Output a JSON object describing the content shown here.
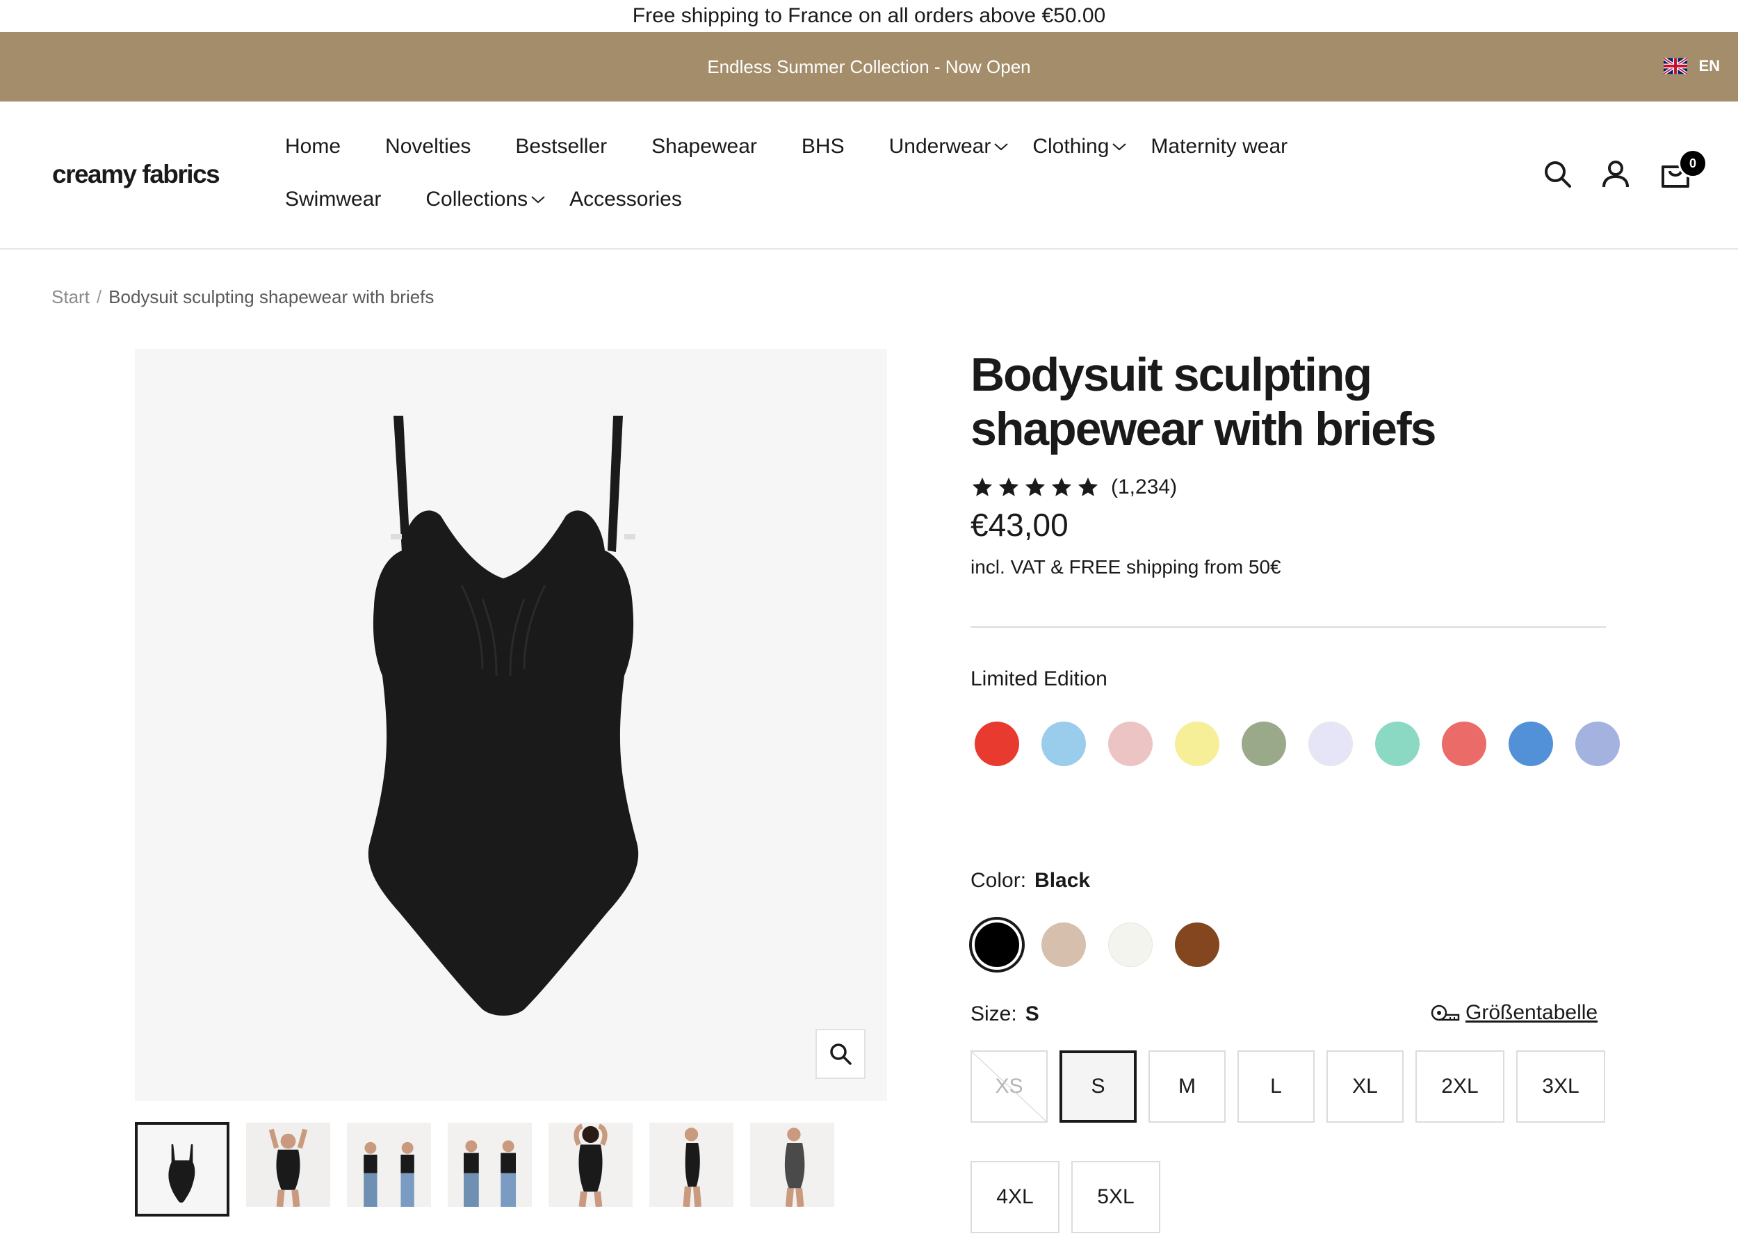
{
  "topbar": {
    "text": "Free shipping to France on all orders above €50.00"
  },
  "announcement": {
    "text": "Endless Summer Collection - Now Open",
    "bg_color": "#a48d6a"
  },
  "language": {
    "code": "EN",
    "flag_icon": "uk-flag-icon"
  },
  "header": {
    "logo": "creamy fabrics",
    "nav_row1": [
      {
        "label": "Home"
      },
      {
        "label": "Novelties"
      },
      {
        "label": "Bestseller"
      },
      {
        "label": "Shapewear"
      },
      {
        "label": "BHS"
      },
      {
        "label": "Underwear",
        "dropdown": true
      },
      {
        "label": "Clothing",
        "dropdown": true
      },
      {
        "label": "Maternity wear"
      }
    ],
    "nav_row2": [
      {
        "label": "Swimwear"
      },
      {
        "label": "Collections",
        "dropdown": true
      },
      {
        "label": "Accessories"
      }
    ],
    "icons": [
      "search-icon",
      "account-icon",
      "cart-icon"
    ],
    "cart_count": "0"
  },
  "breadcrumb": {
    "start": "Start",
    "separator": "/",
    "current": "Bodysuit sculpting shapewear with briefs"
  },
  "product": {
    "title": "Bodysuit sculpting shapewear with briefs",
    "rating": {
      "stars": 5,
      "count": "(1,234)"
    },
    "price": "€43,00",
    "vat_note": "incl. VAT & FREE shipping from 50€",
    "limited_edition_label": "Limited Edition",
    "limited_colors": [
      "#e83a2e",
      "#9acdec",
      "#ecc4c4",
      "#f6ef98",
      "#9aa98a",
      "#e6e5f7",
      "#8cd9c3",
      "#eb6b68",
      "#5291d8",
      "#a3b2df"
    ],
    "color_label": "Color:",
    "color_value": "Black",
    "colors": [
      "#000000",
      "#d7bfad",
      "#f4f4ee",
      "#83461f"
    ],
    "selected_color_index": 0,
    "size_label": "Size:",
    "size_value": "S",
    "size_chart_label": "Größentabelle",
    "sizes": [
      "XS",
      "S",
      "M",
      "L",
      "XL",
      "2XL",
      "3XL",
      "4XL",
      "5XL"
    ],
    "selected_size": "S",
    "disabled_sizes": [
      "XS"
    ]
  },
  "gallery": {
    "thumbnail_count": 7,
    "active_thumbnail": 0
  }
}
